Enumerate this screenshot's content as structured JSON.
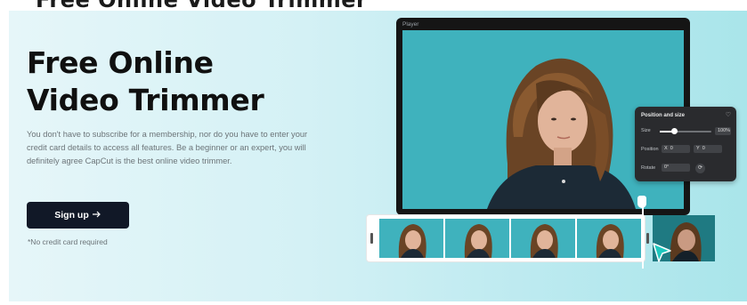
{
  "top_strip": {
    "text": "Free Online Video Trimmer"
  },
  "hero": {
    "title_line1": "Free Online",
    "title_line2": "Video Trimmer",
    "description": "You don't have to subscribe for a membership, nor do you have to enter your credit card details to access all features. Be a beginner or an expert, you will definitely agree CapCut is the best online video trimmer.",
    "cta_label": "Sign up",
    "cta_icon": "arrow-right-icon",
    "note": "*No credit card required"
  },
  "player": {
    "title": "Player"
  },
  "panel": {
    "title": "Position and size",
    "size_label": "Size",
    "size_value": "100%",
    "size_fraction": 0.28,
    "position_label": "Position",
    "x_label": "X",
    "x_value": "0",
    "y_label": "Y",
    "y_value": "0",
    "rotate_label": "Rotate",
    "rotate_value": "0°"
  },
  "colors": {
    "accent": "#111827",
    "video_bg": "#3fb2bd",
    "cursor": "#1fc8be"
  }
}
